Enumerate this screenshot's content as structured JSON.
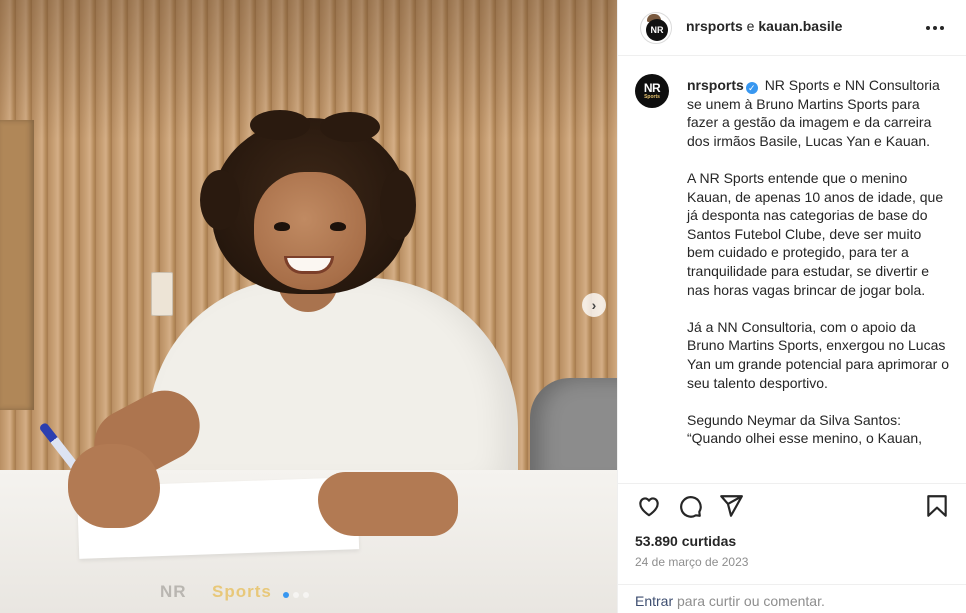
{
  "photo": {
    "desk_logo": "NR",
    "desk_logo_accent": "Sports",
    "carousel_next_icon": "chevron-right-icon",
    "carousel_next_glyph": "›",
    "carousel": {
      "total": 3,
      "active_index": 0
    }
  },
  "header": {
    "account": "nrsports",
    "connector": " e ",
    "collaborator": "kauan.basile",
    "avatar_text": "NR",
    "more_icon": "more-horizontal-icon"
  },
  "post": {
    "avatar_text": "NR",
    "avatar_subtext": "Sports",
    "username": "nrsports",
    "verified_glyph": "✓",
    "paragraphs": [
      "NR Sports e NN Consultoria se unem à Bruno Martins Sports para fazer a gestão da imagem e da carreira dos irmãos Basile, Lucas Yan e Kauan.",
      "A NR Sports entende que o menino Kauan, de apenas 10 anos de idade, que já desponta nas categorias de base do Santos Futebol Clube, deve ser muito bem cuidado e protegido, para ter a tranquilidade para estudar, se divertir e nas horas vagas brincar de jogar bola.",
      "Já a NN Consultoria, com o apoio da Bruno Martins Sports, enxergou no Lucas Yan um grande potencial para aprimorar o seu talento desportivo.",
      "Segundo Neymar da Silva Santos: “Quando olhei esse menino, o Kauan,"
    ]
  },
  "actions": {
    "like_icon": "heart-icon",
    "comment_icon": "comment-icon",
    "share_icon": "send-icon",
    "save_icon": "bookmark-icon"
  },
  "stats": {
    "likes": "53.890 curtidas",
    "date": "24 de março de 2023"
  },
  "login": {
    "link": "Entrar",
    "text": " para curtir ou comentar."
  },
  "colors": {
    "link_blue": "#3e4e70",
    "verified_blue": "#3897f0",
    "muted": "#8e8e8e",
    "text": "#262626"
  }
}
